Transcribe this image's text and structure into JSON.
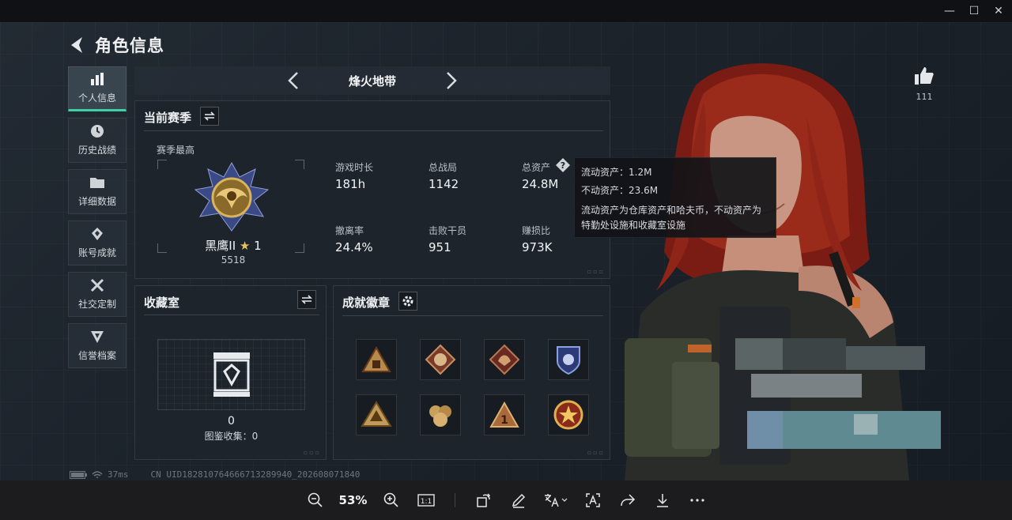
{
  "window": {
    "minimize": "—",
    "maximize": "☐",
    "close": "✕"
  },
  "header": {
    "title": "角色信息"
  },
  "sidebar": {
    "items": [
      {
        "label": "个人信息",
        "icon": "bar-chart-icon",
        "active": true
      },
      {
        "label": "历史战绩",
        "icon": "clock-icon"
      },
      {
        "label": "详细数据",
        "icon": "folder-icon"
      },
      {
        "label": "账号成就",
        "icon": "trophy-icon"
      },
      {
        "label": "社交定制",
        "icon": "tools-icon"
      },
      {
        "label": "信誉档案",
        "icon": "shield-icon"
      }
    ]
  },
  "mode": {
    "name": "烽火地带"
  },
  "season": {
    "title": "当前赛季",
    "best_label": "赛季最高",
    "rank_name": "黑鹰II",
    "rank_stars": "1",
    "rank_points": "5518",
    "stats": [
      {
        "label": "游戏时长",
        "value": "181h"
      },
      {
        "label": "总战局",
        "value": "1142"
      },
      {
        "label": "总资产",
        "value": "24.8M"
      },
      {
        "label": "撤离率",
        "value": "24.4%"
      },
      {
        "label": "击败干员",
        "value": "951"
      },
      {
        "label": "赚损比",
        "value": "973K"
      }
    ]
  },
  "tooltip": {
    "line1": "流动资产：1.2M",
    "line2": "不动资产：23.6M",
    "desc": "流动资产为仓库资产和哈夫币，不动资产为特勤处设施和收藏室设施"
  },
  "collection": {
    "title": "收藏室",
    "count": "0",
    "label": "图鉴收集：0"
  },
  "achievements": {
    "title": "成就徽章",
    "badges": [
      "badge-1",
      "badge-2",
      "badge-3",
      "badge-4",
      "badge-5",
      "badge-6",
      "badge-7",
      "badge-8"
    ]
  },
  "profile": {
    "like_count": "111"
  },
  "status": {
    "ping": "37ms",
    "uid": "CN UID1828107646667132899​40_202608071840"
  },
  "toolbar": {
    "zoom": "53%"
  },
  "colors": {
    "accent": "#3fd1a3",
    "panel": "#1e242c",
    "toolbar": "#1c1c1f"
  }
}
